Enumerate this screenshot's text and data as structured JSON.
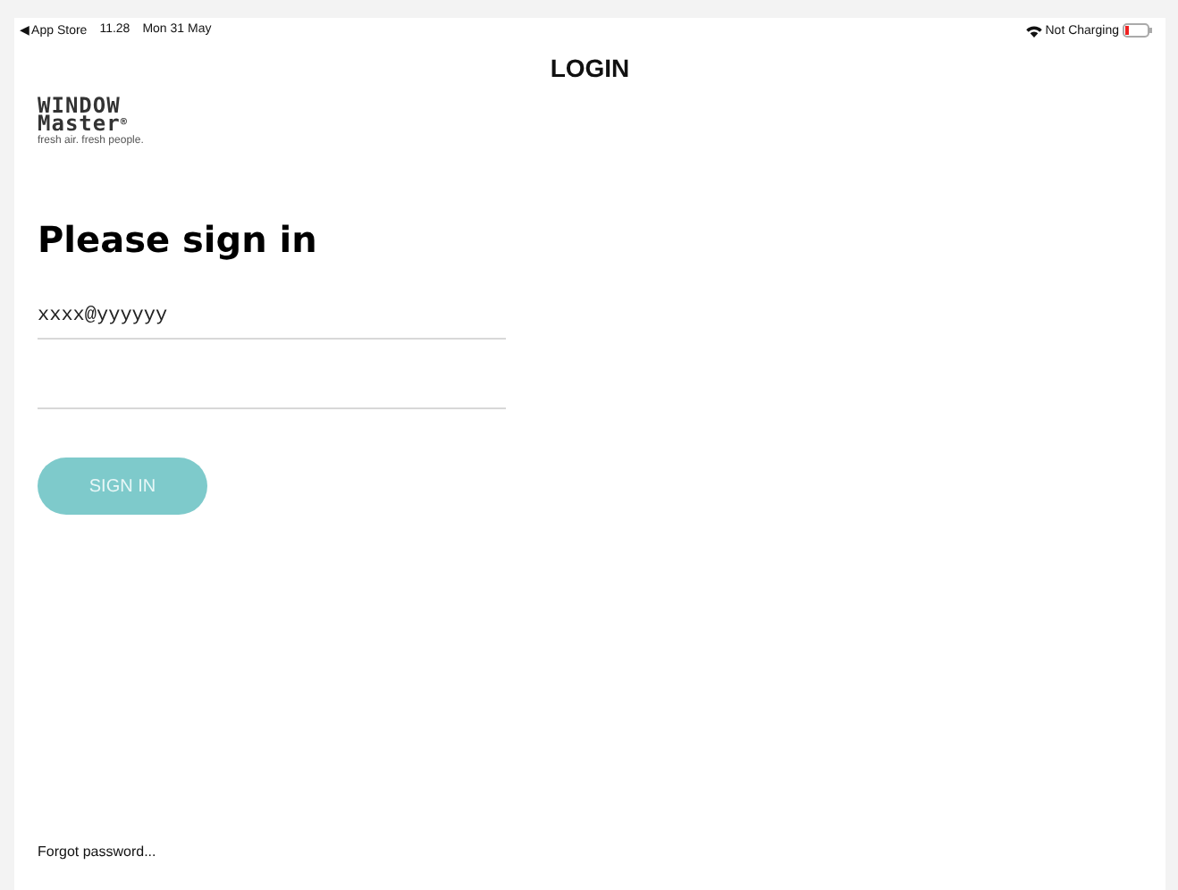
{
  "status_bar": {
    "back_app": "◀ App Store",
    "time": "11.28",
    "date": "Mon 31 May",
    "battery_status": "Not Charging"
  },
  "title": "LOGIN",
  "logo": {
    "line_1": "WINDOW",
    "line_2": "Master",
    "mark": "®",
    "tagline": "fresh air. fresh people."
  },
  "heading": "Please sign in",
  "email_field": {
    "value": "xxxx@yyyyyy"
  },
  "sign_in_button": "SIGN IN",
  "forgot_password_link": "Forgot password..."
}
